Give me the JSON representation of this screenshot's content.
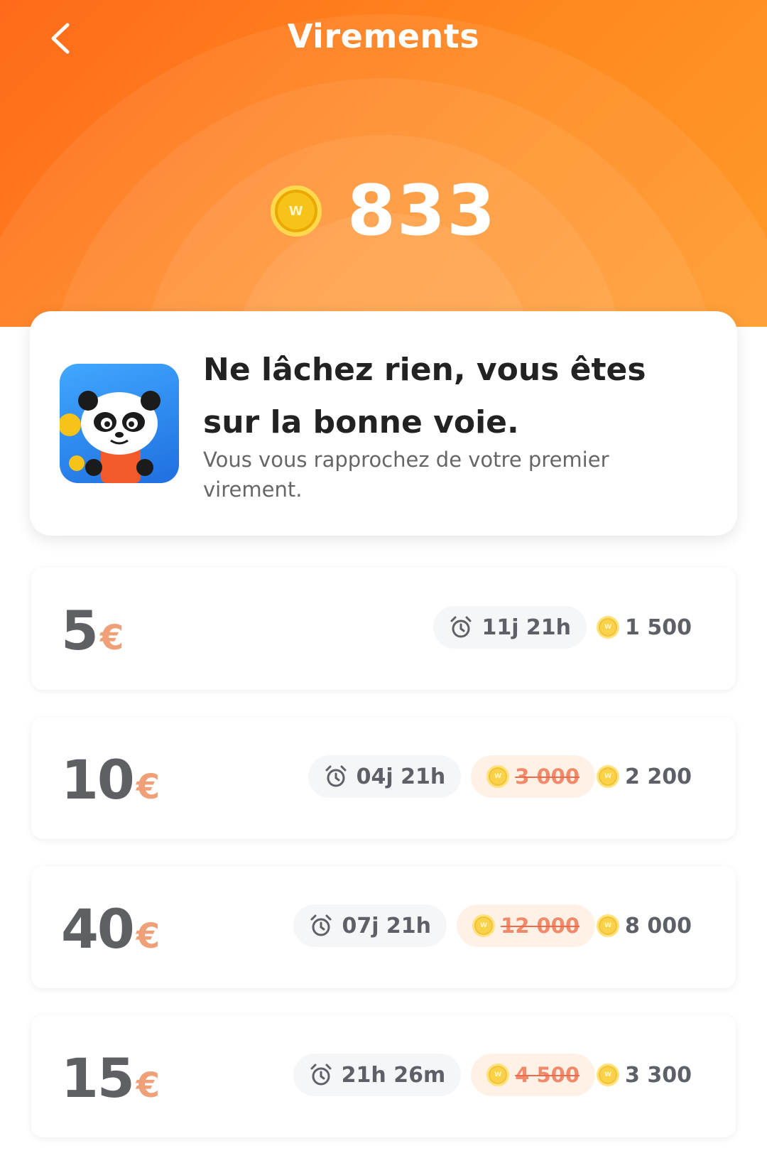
{
  "header": {
    "title": "Virements",
    "back_icon": "chevron-left-icon",
    "balance": "833",
    "coin_letter": "W"
  },
  "motivation": {
    "title": "Ne lâchez rien, vous êtes sur la bonne voie.",
    "subtitle": "Vous vous rapprochez de votre premier virement.",
    "mascot": "panda-mascot-image"
  },
  "offers": [
    {
      "amount": "5",
      "currency": "€",
      "timer": "11j 21h",
      "old_price": "",
      "price": "1 500"
    },
    {
      "amount": "10",
      "currency": "€",
      "timer": "04j 21h",
      "old_price": "3 000",
      "price": "2 200"
    },
    {
      "amount": "40",
      "currency": "€",
      "timer": "07j 21h",
      "old_price": "12 000",
      "price": "8 000"
    },
    {
      "amount": "15",
      "currency": "€",
      "timer": "21h 26m",
      "old_price": "4 500",
      "price": "3 300"
    }
  ],
  "colors": {
    "header_orange": "#ff7a1c",
    "coin_gold": "#f7c319",
    "currency_accent": "#f0a078",
    "discount_bg": "#fff1e6"
  }
}
